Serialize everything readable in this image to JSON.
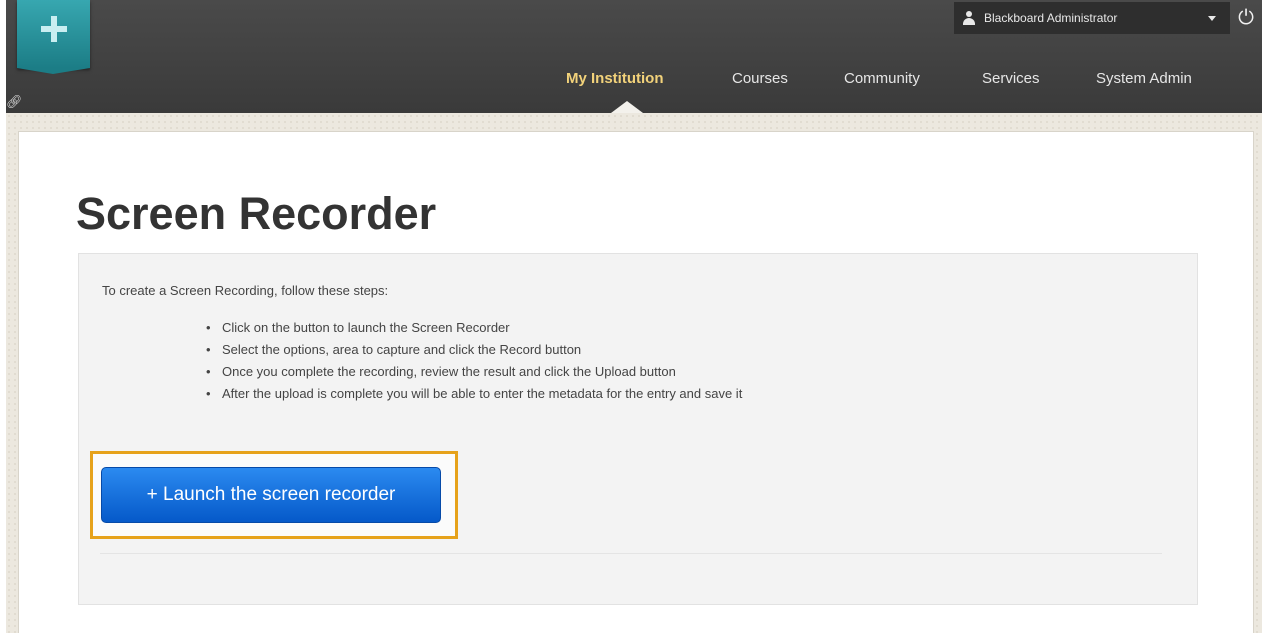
{
  "header": {
    "user_name": "Blackboard Administrator",
    "nav": [
      {
        "label": "My Institution",
        "active": true
      },
      {
        "label": "Courses",
        "active": false
      },
      {
        "label": "Community",
        "active": false
      },
      {
        "label": "Services",
        "active": false
      },
      {
        "label": "System Admin",
        "active": false
      }
    ]
  },
  "page": {
    "title": "Screen Recorder",
    "intro": "To create a Screen Recording, follow these steps:",
    "steps": [
      "Click on the button to launch the Screen Recorder",
      "Select the options, area to capture and click the Record button",
      "Once you complete the recording, review the result and click the Upload button",
      "After the upload is complete you will be able to enter the metadata for the entry and save it"
    ],
    "launch_button_label": "+ Launch the screen recorder"
  },
  "colors": {
    "header_bg": "#3f3f3f",
    "active_nav": "#f2d27a",
    "logo_teal": "#2a96a0",
    "button_blue": "#0a66d6",
    "highlight_border": "#e6a21b"
  },
  "icons": {
    "logo": "plus-icon",
    "user": "user-icon",
    "dropdown": "chevron-down-icon",
    "power": "power-icon",
    "link": "link-icon"
  }
}
